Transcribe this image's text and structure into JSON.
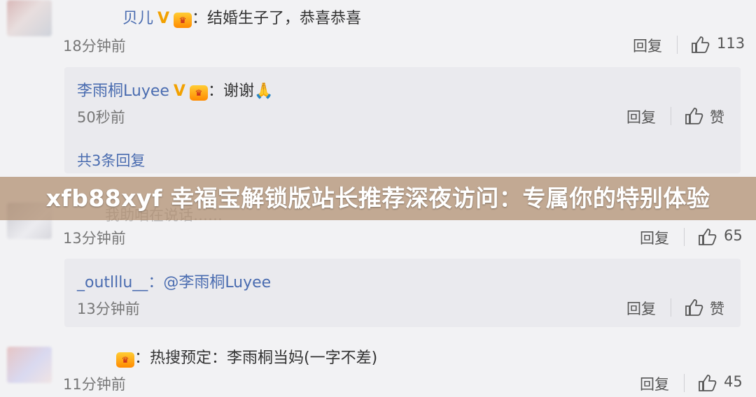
{
  "comments": [
    {
      "username": "贝儿",
      "text": "：结婚生子了，恭喜恭喜",
      "time": "18分钟前",
      "reply_label": "回复",
      "likes": "113",
      "reply": {
        "username": "李雨桐Luyee",
        "text": "：谢谢🙏",
        "time": "50秒前",
        "reply_label": "回复",
        "like_label": "赞"
      },
      "more_replies": "共3条回复"
    },
    {
      "partial_text": "我助咱在说话……",
      "time": "13分钟前",
      "reply_label": "回复",
      "likes": "65",
      "reply": {
        "username": "_outlllu__",
        "text": "：@李雨桐Luyee",
        "time": "13分钟前",
        "reply_label": "回复",
        "like_label": "赞"
      }
    },
    {
      "text": "：热搜预定：李雨桐当妈(一字不差)",
      "time": "11分钟前",
      "reply_label": "回复",
      "likes": "45"
    }
  ],
  "banner": {
    "title": "xfb88xyf 幸福宝解锁版站长推荐深夜访问：专属你的特别体验"
  },
  "colors": {
    "username": "#4a6cb0",
    "banner_bg": "#af8c6e",
    "badge_v": "#f2a100"
  }
}
